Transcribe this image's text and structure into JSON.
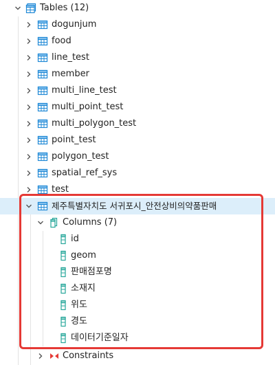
{
  "tree": {
    "tables_node": {
      "label": "Tables (12)",
      "icon": "tables-folder-icon"
    },
    "tables": [
      {
        "label": "dogunjum",
        "icon": "table-icon"
      },
      {
        "label": "food",
        "icon": "table-icon"
      },
      {
        "label": "line_test",
        "icon": "table-icon"
      },
      {
        "label": "member",
        "icon": "table-icon"
      },
      {
        "label": "multi_line_test",
        "icon": "table-icon"
      },
      {
        "label": "multi_point_test",
        "icon": "table-icon"
      },
      {
        "label": "multi_polygon_test",
        "icon": "table-icon"
      },
      {
        "label": "point_test",
        "icon": "table-icon"
      },
      {
        "label": "polygon_test",
        "icon": "table-icon"
      },
      {
        "label": "spatial_ref_sys",
        "icon": "table-icon"
      },
      {
        "label": "test",
        "icon": "table-icon"
      }
    ],
    "expanded_table": {
      "label": "제주특별자치도 서귀포시_안전상비의약품판매",
      "icon": "table-icon"
    },
    "columns_node": {
      "label": "Columns (7)",
      "icon": "columns-icon"
    },
    "columns": [
      {
        "label": "id",
        "icon": "column-icon"
      },
      {
        "label": "geom",
        "icon": "column-icon"
      },
      {
        "label": "판매점포명",
        "icon": "column-icon"
      },
      {
        "label": "소재지",
        "icon": "column-icon"
      },
      {
        "label": "위도",
        "icon": "column-icon"
      },
      {
        "label": "경도",
        "icon": "column-icon"
      },
      {
        "label": "데이터기준일자",
        "icon": "column-icon"
      }
    ],
    "constraints_node": {
      "label": "Constraints",
      "icon": "constraints-icon"
    }
  },
  "colors": {
    "selected_row": "#dceefa",
    "highlight_border": "#e53935",
    "table_icon": "#1e88d6",
    "column_icon": "#26a69a",
    "constraints_icon": "#e53935"
  }
}
